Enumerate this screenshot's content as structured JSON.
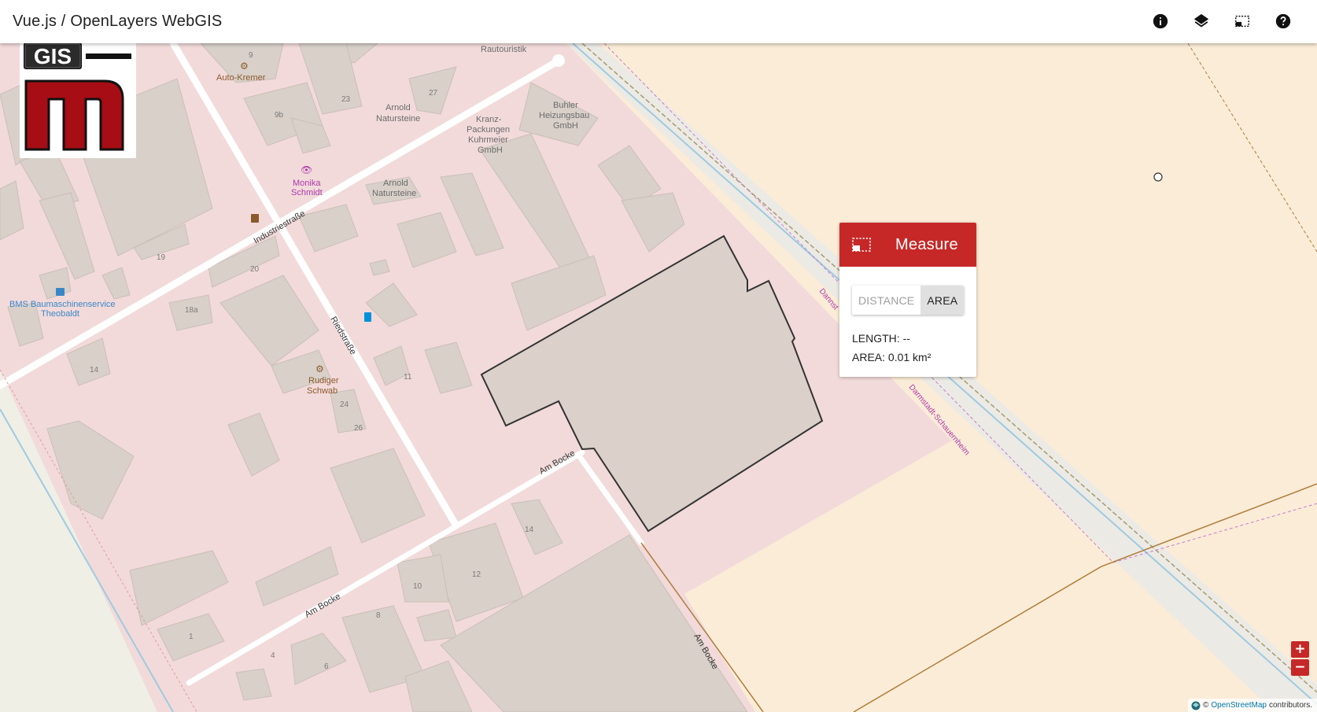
{
  "app": {
    "title": "Vue.js / OpenLayers WebGIS"
  },
  "toolbar": {
    "buttons": [
      {
        "name": "info-button",
        "icon": "info-icon"
      },
      {
        "name": "layers-button",
        "icon": "layers-icon"
      },
      {
        "name": "measure-button",
        "icon": "selection-rect-icon"
      },
      {
        "name": "help-button",
        "icon": "help-icon"
      }
    ]
  },
  "logo": {
    "text": "GIS",
    "letter": "m"
  },
  "measure": {
    "title": "Measure",
    "modes": {
      "distance": "DISTANCE",
      "area": "AREA",
      "active": "area"
    },
    "length_label": "LENGTH:",
    "length_value": "--",
    "area_label": "AREA:",
    "area_value": "0.01 km²"
  },
  "zoom": {
    "in": "+",
    "out": "−"
  },
  "attribution": {
    "prefix": "©",
    "link": "OpenStreetMap",
    "suffix": "contributors."
  },
  "map_labels": {
    "rautouristik": "Rautouristik",
    "auto_kremer": "Auto-Kremer",
    "arnold1_a": "Arnold",
    "arnold1_b": "Natursteine",
    "kranz_a": "Kranz-",
    "kranz_b": "Packungen",
    "kranz_c": "Kuhrmeier",
    "kranz_d": "GmbH",
    "buhler_a": "Buhler",
    "buhler_b": "Heizungsbau",
    "buhler_c": "GmbH",
    "monika_a": "Monika",
    "monika_b": "Schmidt",
    "arnold2_a": "Arnold",
    "arnold2_b": "Natursteine",
    "industriestrasse": "Industriestraße",
    "bms_a": "BMS Baumaschinenservice",
    "bms_b": "Theobaldt",
    "riedstrasse": "Riedstraße",
    "rudiger_a": "Rudiger",
    "rudiger_b": "Schwab",
    "am_bocke_1": "Am Bocke",
    "am_bocke_2": "Am Bocke",
    "am_bocke_3": "Am Bocke",
    "darmstadt": "Darmstadt-Schauernheim",
    "dannst": "Dannst",
    "hn_9": "9",
    "hn_27": "27",
    "hn_23": "23",
    "hn_9b": "9b",
    "hn_19": "19",
    "hn_20": "20",
    "hn_18a": "18a",
    "hn_14a": "14",
    "hn_11": "11",
    "hn_24": "24",
    "hn_26": "26",
    "hn_14b": "14",
    "hn_12": "12",
    "hn_10": "10",
    "hn_8": "8",
    "hn_6": "6",
    "hn_4": "4",
    "hn_1": "1"
  },
  "colors": {
    "accent": "#c62828",
    "industrial": "#f2dada",
    "farmland": "#fbecd7",
    "building": "#d9d0c9",
    "road": "#ffffff",
    "railway_blue": "#9ecae1",
    "border_purple": "#c77dd0"
  }
}
